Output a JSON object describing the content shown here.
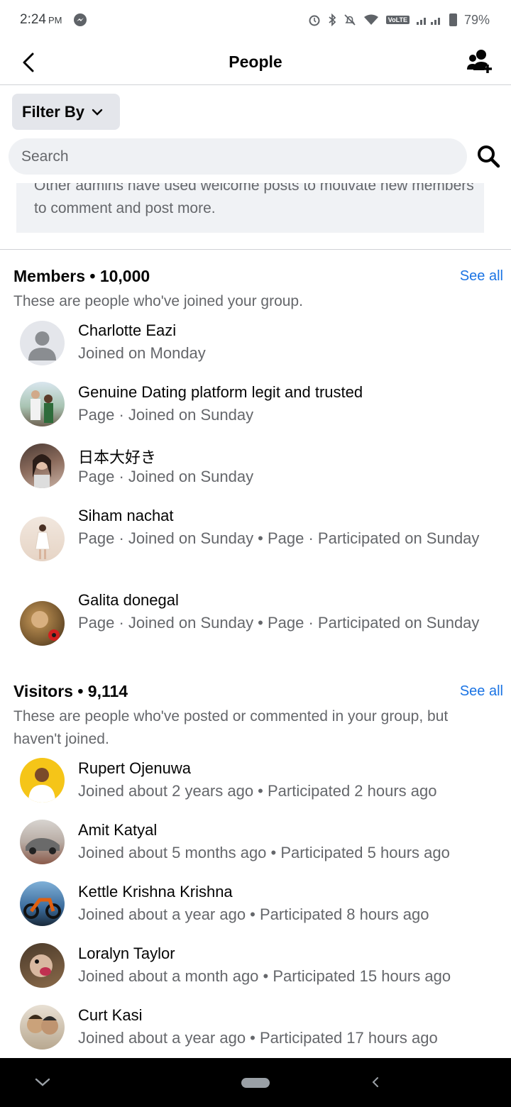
{
  "status_bar": {
    "time": "2:24",
    "ampm": "PM",
    "network": "VoLTE",
    "battery": "79%"
  },
  "header": {
    "title": "People"
  },
  "filter": {
    "label": "Filter By"
  },
  "search": {
    "placeholder": "Search"
  },
  "tip": {
    "text": "Other admins have used welcome posts to motivate new members to comment and post more."
  },
  "members": {
    "title": "Members • 10,000",
    "see_all": "See all",
    "subtitle": "These are people who've joined your group.",
    "items": [
      {
        "name": "Charlotte Eazi",
        "meta": "Joined on Monday"
      },
      {
        "name": "Genuine Dating platform legit and trusted",
        "meta": "Page · Joined on Sunday"
      },
      {
        "name": "日本大好き",
        "meta": "Page · Joined on Sunday"
      },
      {
        "name": "Siham nachat",
        "meta": "Page · Joined on Sunday • Page · Participated on Sunday"
      },
      {
        "name": "Galita donegal",
        "meta": "Page · Joined on Sunday • Page · Participated on Sunday"
      }
    ]
  },
  "visitors": {
    "title": "Visitors • 9,114",
    "see_all": "See all",
    "subtitle": "These are people who've posted or commented in your group, but haven't joined.",
    "items": [
      {
        "name": "Rupert Ojenuwa",
        "meta": "Joined about 2 years ago • Participated 2 hours ago"
      },
      {
        "name": "Amit Katyal",
        "meta": "Joined about 5 months ago • Participated 5 hours ago"
      },
      {
        "name": "Kettle Krishna Krishna",
        "meta": "Joined about a year ago • Participated 8 hours ago"
      },
      {
        "name": "Loralyn Taylor",
        "meta": "Joined about a month ago • Participated 15 hours ago"
      },
      {
        "name": "Curt Kasi",
        "meta": "Joined about a year ago • Participated 17 hours ago"
      }
    ]
  },
  "colors": {
    "accent": "#1b74e4",
    "secondary_text": "#65676b",
    "chip_bg": "#e4e6eb"
  }
}
